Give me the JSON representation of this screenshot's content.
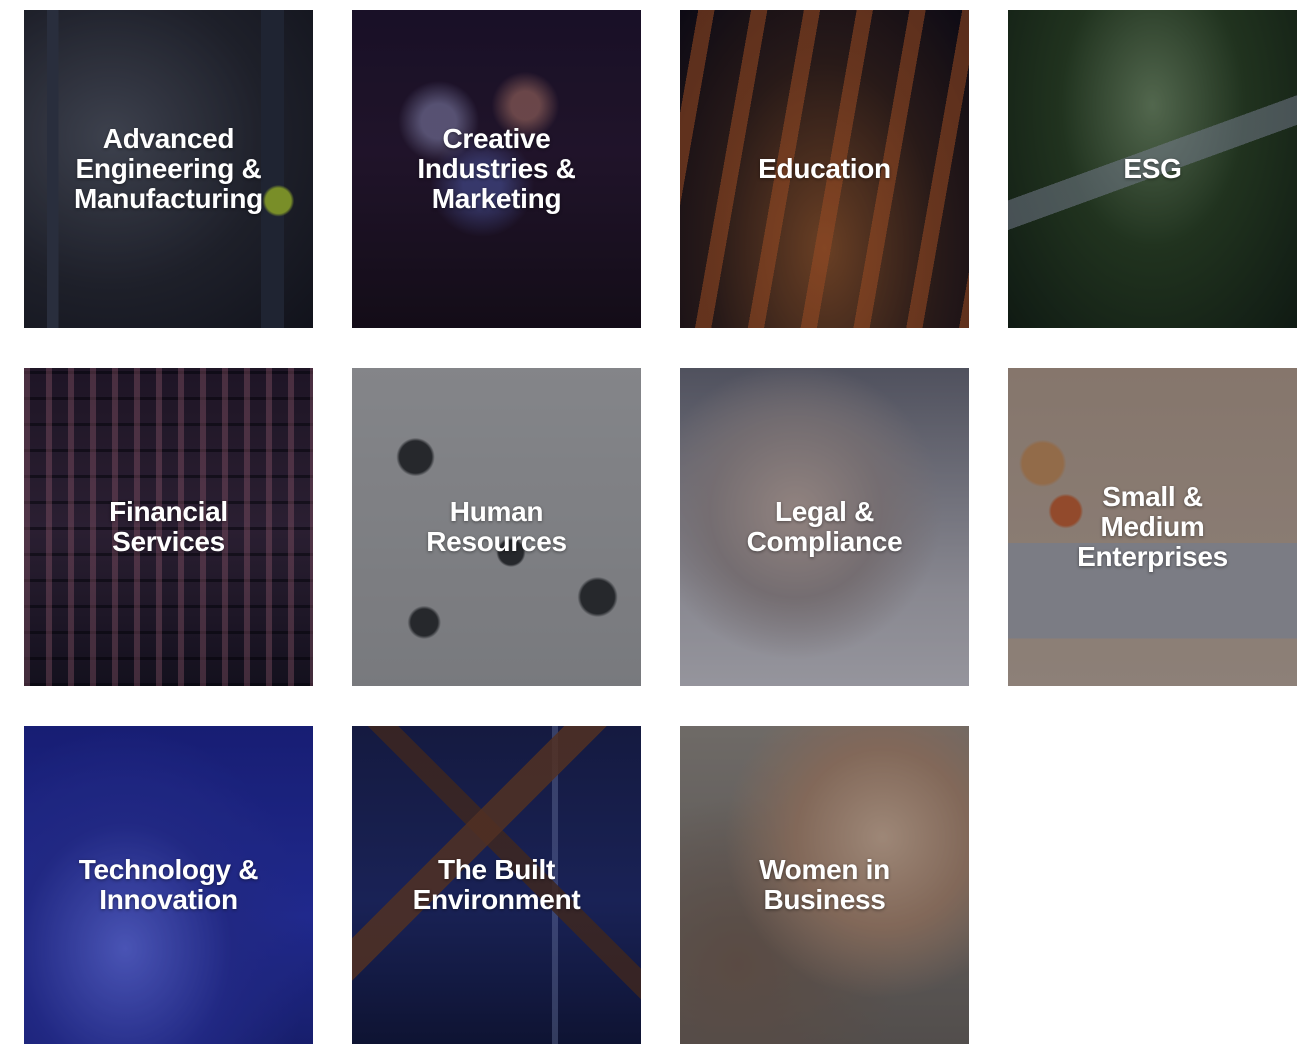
{
  "tiles": [
    {
      "label": "Advanced\nEngineering &\nManufacturing"
    },
    {
      "label": "Creative\nIndustries &\nMarketing"
    },
    {
      "label": "Education"
    },
    {
      "label": "ESG"
    },
    {
      "label": "Financial\nServices"
    },
    {
      "label": "Human\nResources"
    },
    {
      "label": "Legal &\nCompliance"
    },
    {
      "label": "Small &\nMedium\nEnterprises"
    },
    {
      "label": "Technology &\nInnovation"
    },
    {
      "label": "The Built\nEnvironment"
    },
    {
      "label": "Women in\nBusiness"
    }
  ]
}
